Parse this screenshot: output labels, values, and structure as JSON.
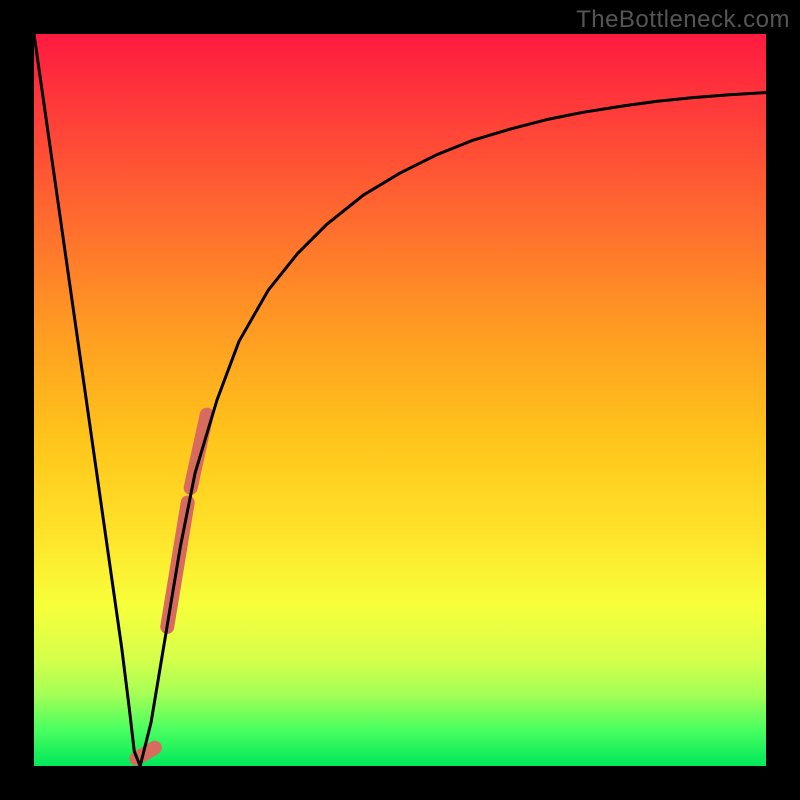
{
  "watermark": "TheBottleneck.com",
  "chart_data": {
    "type": "line",
    "title": "",
    "xlabel": "",
    "ylabel": "",
    "xlim": [
      0,
      100
    ],
    "ylim": [
      0,
      100
    ],
    "series": [
      {
        "name": "bottleneck-curve",
        "x": [
          0,
          2,
          4,
          6,
          8,
          10,
          12,
          13,
          13.7,
          14.5,
          16,
          18,
          20,
          22,
          25,
          28,
          32,
          36,
          40,
          45,
          50,
          55,
          60,
          65,
          70,
          75,
          80,
          85,
          90,
          95,
          100
        ],
        "y": [
          100,
          86,
          72,
          58,
          44,
          30,
          16,
          8,
          2,
          0,
          6,
          18,
          30,
          40,
          50,
          58,
          65,
          70,
          74,
          78,
          81,
          83.5,
          85.5,
          87,
          88.3,
          89.3,
          90.1,
          90.8,
          91.3,
          91.7,
          92
        ]
      }
    ],
    "markers": [
      {
        "name": "highlight-dash-1",
        "x1": 18.2,
        "y1": 19,
        "x2": 21.0,
        "y2": 36,
        "color": "#d96a5e",
        "width": 14
      },
      {
        "name": "highlight-dash-2",
        "x1": 21.4,
        "y1": 38,
        "x2": 23.6,
        "y2": 48,
        "color": "#d96a5e",
        "width": 14
      },
      {
        "name": "highlight-dot",
        "x1": 14.0,
        "y1": 1,
        "x2": 16.5,
        "y2": 2.5,
        "color": "#d96a5e",
        "width": 14
      }
    ]
  }
}
